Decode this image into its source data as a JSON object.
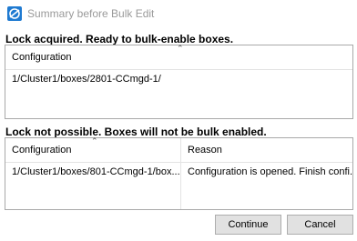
{
  "window": {
    "title": "Summary before Bulk Edit"
  },
  "lock_acquired": {
    "label": "Lock acquired. Ready to bulk-enable boxes.",
    "columns": [
      "Configuration"
    ],
    "rows": [
      [
        "1/Cluster1/boxes/2801-CCmgd-1/"
      ]
    ]
  },
  "lock_failed": {
    "label": "Lock not possible. Boxes will not be bulk enabled.",
    "columns": [
      "Configuration",
      "Reason"
    ],
    "rows": [
      [
        "1/Cluster1/boxes/801-CCmgd-1/box...",
        "Configuration is opened. Finish confi..."
      ]
    ]
  },
  "buttons": {
    "continue": "Continue",
    "cancel": "Cancel"
  }
}
